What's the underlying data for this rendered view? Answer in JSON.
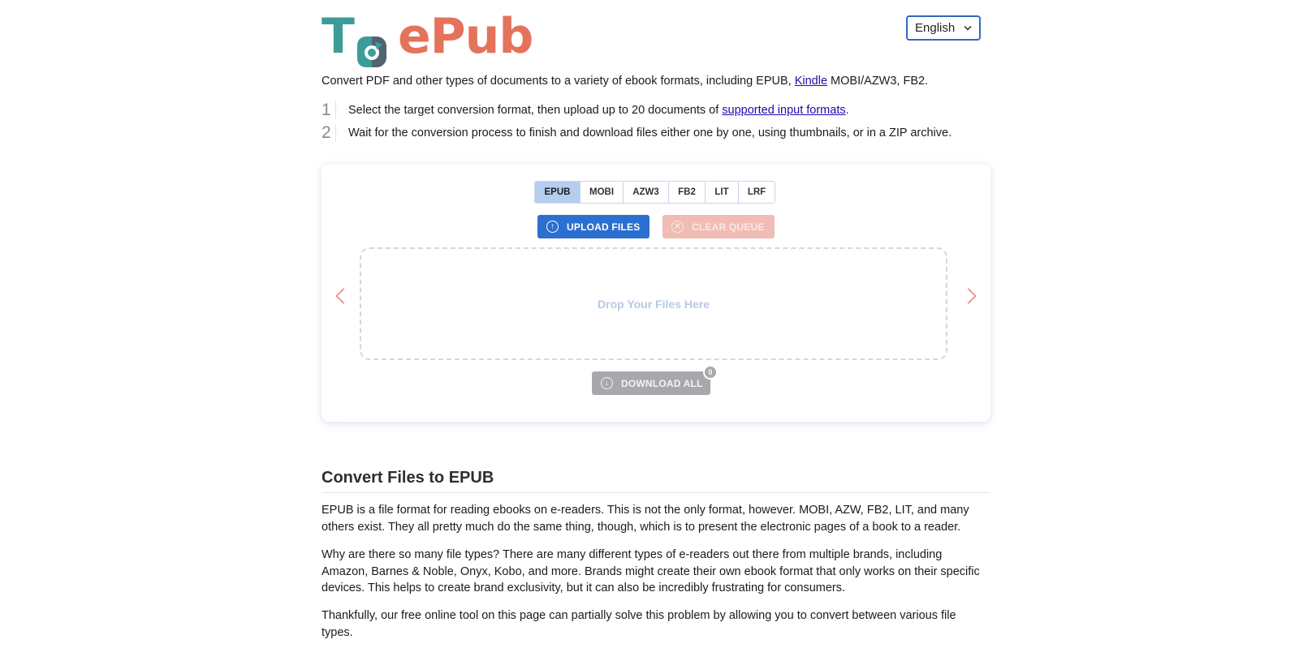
{
  "header": {
    "logo": {
      "part1": "T",
      "part2": "ePub",
      "icon": "convert-arrows-icon"
    },
    "language_selector": {
      "selected": "English"
    }
  },
  "intro": {
    "text_before": "Convert PDF and other types of documents to a variety of ebook formats, including EPUB, ",
    "link": "Kindle",
    "text_after": " MOBI/AZW3, FB2."
  },
  "steps": [
    {
      "number": "1",
      "text_before": "Select the target conversion format, then upload up to 20 documents of ",
      "link": "supported input formats",
      "text_after": "."
    },
    {
      "number": "2",
      "text_before": "Wait for the conversion process to finish and download files either one by one, using thumbnails, or in a ZIP archive.",
      "link": "",
      "text_after": ""
    }
  ],
  "converter": {
    "formats": [
      {
        "label": "EPUB",
        "active": true
      },
      {
        "label": "MOBI",
        "active": false
      },
      {
        "label": "AZW3",
        "active": false
      },
      {
        "label": "FB2",
        "active": false
      },
      {
        "label": "LIT",
        "active": false
      },
      {
        "label": "LRF",
        "active": false
      }
    ],
    "upload_label": "UPLOAD FILES",
    "clear_label": "CLEAR QUEUE",
    "drop_text": "Drop Your Files Here",
    "download_label": "DOWNLOAD ALL",
    "download_count": "0"
  },
  "article": {
    "title": "Convert Files to EPUB",
    "paragraphs": [
      "EPUB is a file format for reading ebooks on e-readers. This is not the only format, however. MOBI, AZW, FB2, LIT, and many others exist. They all pretty much do the same thing, though, which is to present the electronic pages of a book to a reader.",
      "Why are there so many file types? There are many different types of e-readers out there from multiple brands, including Amazon, Barnes & Noble, Onyx, Kobo, and more. Brands might create their own ebook format that only works on their specific devices. This helps to create brand exclusivity, but it can also be incredibly frustrating for consumers.",
      "Thankfully, our free online tool on this page can partially solve this problem by allowing you to convert between various file types."
    ]
  },
  "colors": {
    "teal": "#3d9c9a",
    "coral": "#e4735c",
    "primary": "#2b6fd0",
    "active_tab": "#b5cdf0"
  }
}
